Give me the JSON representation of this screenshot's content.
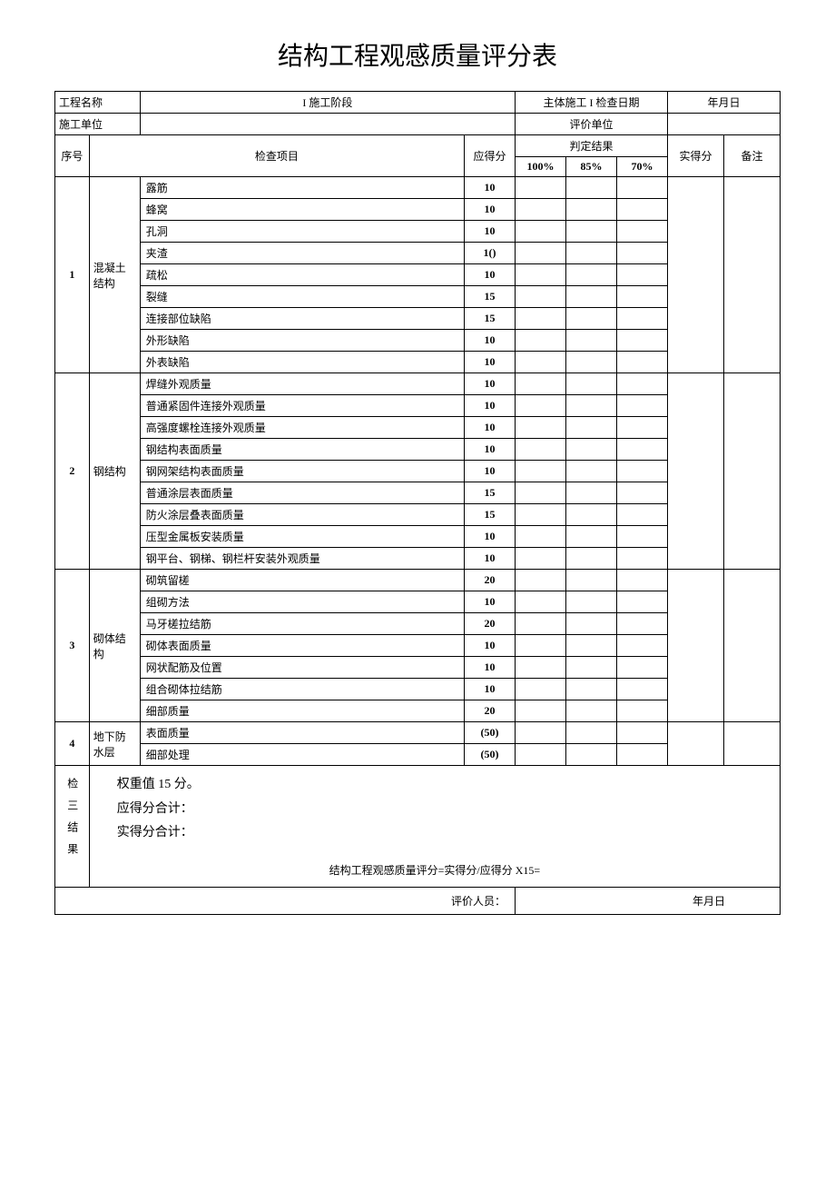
{
  "title": "结构工程观感质量评分表",
  "header": {
    "project_name_label": "工程名称",
    "stage_label": "I 施工阶段",
    "stage_value": "主体施工 I 检查日期",
    "date_placeholder": "年月日",
    "unit_label": "施工单位",
    "eval_unit_label": "评价单位"
  },
  "columns": {
    "seq": "序号",
    "item": "检查项目",
    "max_score": "应得分",
    "judge": "判定结果",
    "pct100": "100%",
    "pct85": "85%",
    "pct70": "70%",
    "actual": "实得分",
    "remark": "备注"
  },
  "sections": [
    {
      "seq": "1",
      "category": "混凝土结构",
      "items": [
        {
          "name": "露筋",
          "score": "10"
        },
        {
          "name": "蜂窝",
          "score": "10"
        },
        {
          "name": "孔洞",
          "score": "10"
        },
        {
          "name": "夹渣",
          "score": "1()"
        },
        {
          "name": "疏松",
          "score": "10"
        },
        {
          "name": "裂缝",
          "score": "15"
        },
        {
          "name": "连接部位缺陷",
          "score": "15"
        },
        {
          "name": "外形缺陷",
          "score": "10"
        },
        {
          "name": "外表缺陷",
          "score": "10"
        }
      ]
    },
    {
      "seq": "2",
      "category": "钢结构",
      "items": [
        {
          "name": "焊缝外观质量",
          "score": "10"
        },
        {
          "name": "普通紧固件连接外观质量",
          "score": "10"
        },
        {
          "name": "高强度螺栓连接外观质量",
          "score": "10"
        },
        {
          "name": "钢结构表面质量",
          "score": "10"
        },
        {
          "name": "钢网架结构表面质量",
          "score": "10"
        },
        {
          "name": "普通涂层表面质量",
          "score": "15"
        },
        {
          "name": "防火涂层叠表面质量",
          "score": "15"
        },
        {
          "name": "压型金属板安装质量",
          "score": "10"
        },
        {
          "name": "钢平台、钢梯、钢栏杆安装外观质量",
          "score": "10"
        }
      ]
    },
    {
      "seq": "3",
      "category": "砌体结构",
      "items": [
        {
          "name": "砌筑留槎",
          "score": "20"
        },
        {
          "name": "组砌方法",
          "score": "10"
        },
        {
          "name": "马牙槎拉结筋",
          "score": "20"
        },
        {
          "name": "砌体表面质量",
          "score": "10"
        },
        {
          "name": "网状配筋及位置",
          "score": "10"
        },
        {
          "name": "组合砌体拉结筋",
          "score": "10"
        },
        {
          "name": "细部质量",
          "score": "20"
        }
      ]
    },
    {
      "seq": "4",
      "category": "地下防水层",
      "items": [
        {
          "name": "表面质量",
          "score": "(50)"
        },
        {
          "name": "细部处理",
          "score": "(50)"
        }
      ]
    }
  ],
  "footer": {
    "vert_label": "检三结果",
    "weight_line": "权重值 15 分。",
    "max_total_line": "应得分合计：",
    "actual_total_line": "实得分合计：",
    "formula": "结构工程观感质量评分=实得分/应得分 X15=",
    "evaluator_label": "评价人员：",
    "date_label": "年月日"
  }
}
